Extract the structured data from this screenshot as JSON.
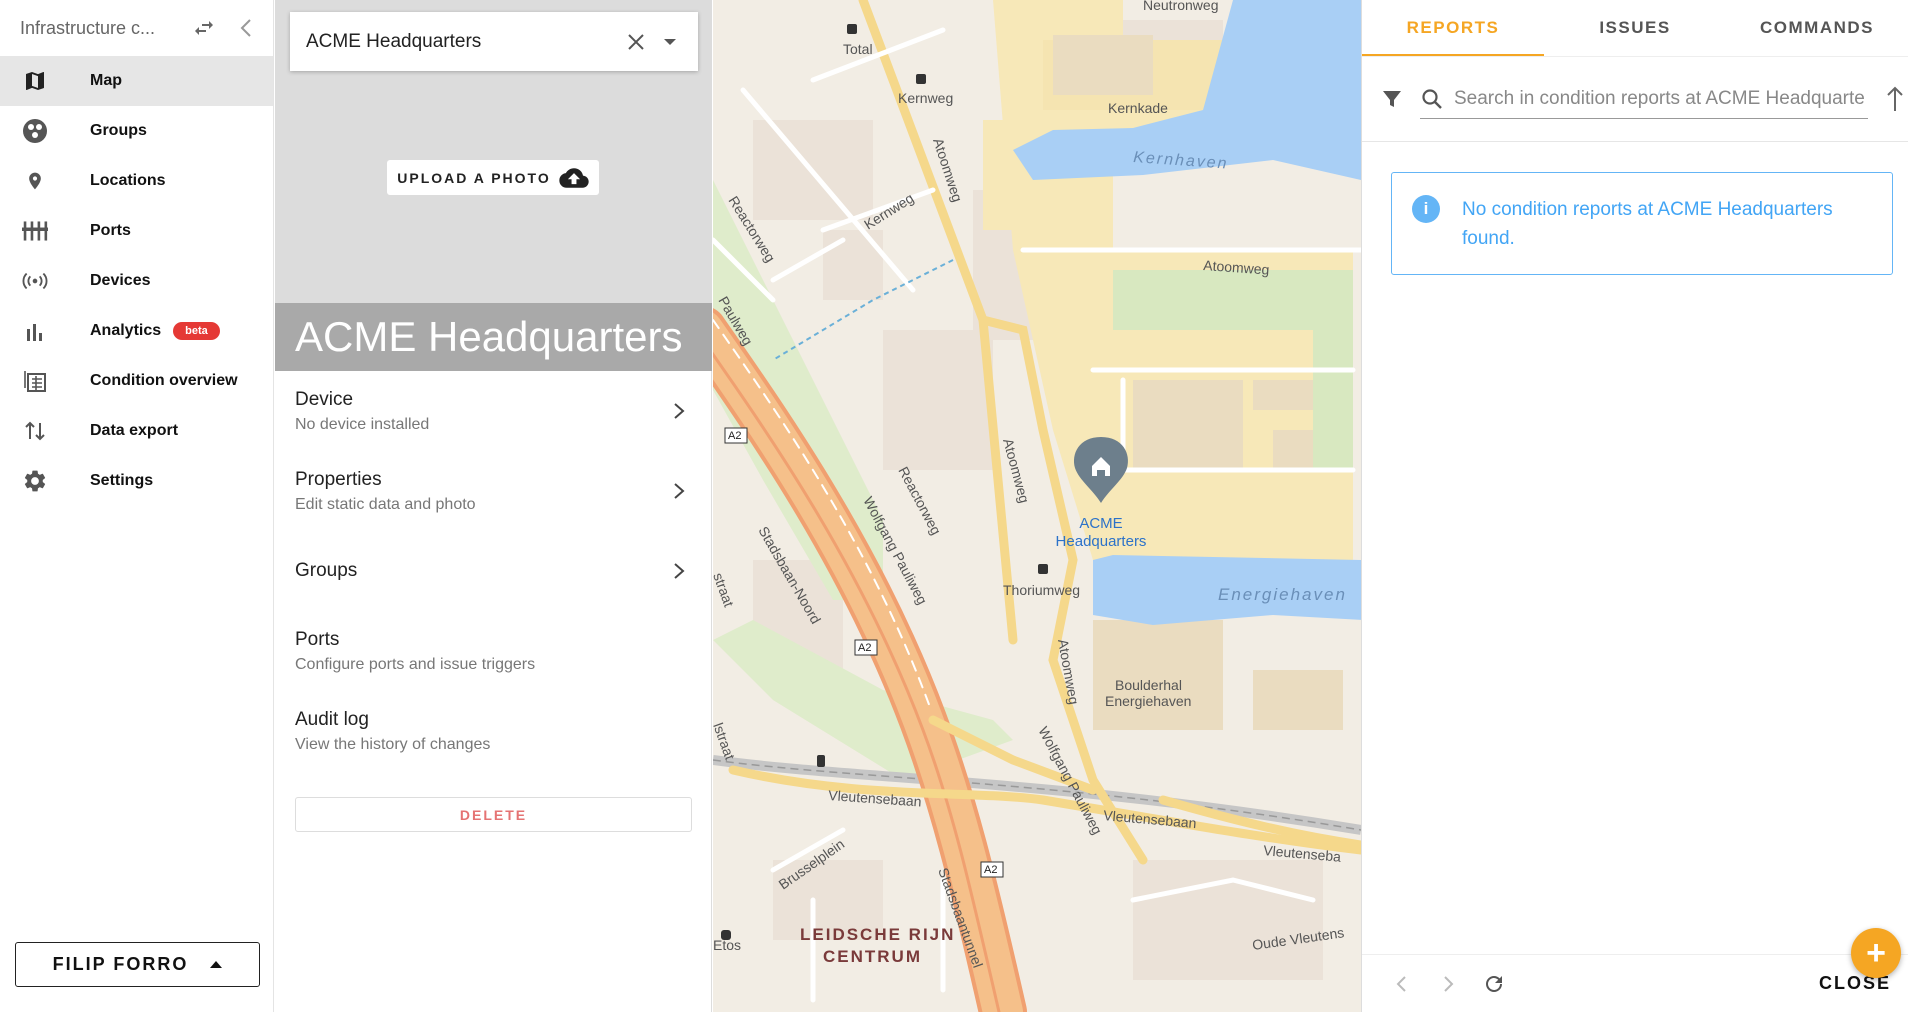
{
  "nav": {
    "org_name": "Infrastructure c...",
    "items": [
      {
        "label": "Map",
        "icon": "map-icon",
        "active": true
      },
      {
        "label": "Groups",
        "icon": "groups-icon"
      },
      {
        "label": "Locations",
        "icon": "location-pin-icon"
      },
      {
        "label": "Ports",
        "icon": "ports-icon"
      },
      {
        "label": "Devices",
        "icon": "devices-icon"
      },
      {
        "label": "Analytics",
        "icon": "analytics-icon",
        "badge": "beta"
      },
      {
        "label": "Condition overview",
        "icon": "condition-overview-icon"
      },
      {
        "label": "Data export",
        "icon": "data-export-icon"
      },
      {
        "label": "Settings",
        "icon": "gear-icon"
      }
    ],
    "user": "FILIP FORRO"
  },
  "location": {
    "selected": "ACME Headquarters",
    "upload_label": "UPLOAD A PHOTO",
    "title": "ACME Headquarters",
    "menu": [
      {
        "title": "Device",
        "subtitle": "No device installed",
        "chevron": true
      },
      {
        "title": "Properties",
        "subtitle": "Edit static data and photo",
        "chevron": true
      },
      {
        "title": "Groups",
        "subtitle": "",
        "chevron": true
      },
      {
        "title": "Ports",
        "subtitle": "Configure ports and issue triggers",
        "chevron": false
      },
      {
        "title": "Audit log",
        "subtitle": "View the history of changes",
        "chevron": false
      }
    ],
    "delete_label": "DELETE"
  },
  "map": {
    "marker_label_line1": "ACME",
    "marker_label_line2": "Headquarters",
    "labels": {
      "total": "Total",
      "kernweg_top": "Kernweg",
      "kernkade": "Kernkade",
      "neutronweg": "Neutronweg",
      "kernhaven": "Kernhaven",
      "atoomweg_top": "Atoomweg",
      "kernweg_mid": "Kernweg",
      "atoomweg_vert1": "Atoomweg",
      "reactorweg_top": "Reactorweg",
      "pauliweg_left": "Paulweg",
      "a2_1": "A2",
      "reactorweg_mid": "Reactorweg",
      "atoomweg_vert2": "Atoomweg",
      "wolfgang_pauliweg": "Wolfgang Pauliweg",
      "thoriumweg": "Thoriumweg",
      "energiehaven": "Energiehaven",
      "stadsbaan_noord": "Stadsbaan-Noord",
      "a2_2": "A2",
      "straat": "straat",
      "atoomweg_vert3": "Atoomweg",
      "boulderhal_1": "Boulderhal",
      "boulderhal_2": "Energiehaven",
      "wolfgang_pauliweg_2": "Wolfgang Pauliweg",
      "vleutensebaan_1": "Vleutensebaan",
      "vleutensebaan_2": "Vleutensebaan",
      "vleutensebaan_3": "Vleutenseba",
      "brusselplein": "Brusselplein",
      "a2_3": "A2",
      "stadsbaantunnel": "Stadsbaantunnel",
      "leidsche_1": "LEIDSCHE RIJN",
      "leidsche_2": "CENTRUM",
      "etos": "Etos",
      "oude_vleutens": "Oude Vleutens",
      "lstraat": "lstraat"
    }
  },
  "reports": {
    "tabs": [
      {
        "label": "REPORTS",
        "active": true
      },
      {
        "label": "ISSUES"
      },
      {
        "label": "COMMANDS"
      }
    ],
    "search_placeholder": "Search in condition reports at ACME Headquarters",
    "empty_message": "No condition reports at ACME Headquarters found.",
    "close_label": "CLOSE",
    "accent_color": "#f5a623",
    "info_color": "#42a5f5"
  }
}
